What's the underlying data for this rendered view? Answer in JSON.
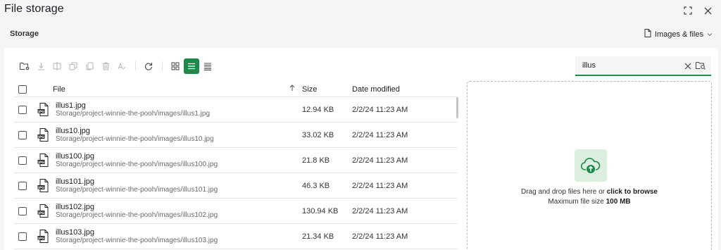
{
  "window": {
    "title": "File storage"
  },
  "breadcrumb": "Storage",
  "scope": {
    "label": "Images & files"
  },
  "search": {
    "value": "illus",
    "placeholder": ""
  },
  "table": {
    "headers": {
      "file": "File",
      "size": "Size",
      "date": "Date modified"
    },
    "rows": [
      {
        "name": "illus1.jpg",
        "path": "Storage/project-winnie-the-pooh/images/illus1.jpg",
        "size": "12.94 KB",
        "date": "2/2/24 11:23 AM"
      },
      {
        "name": "illus10.jpg",
        "path": "Storage/project-winnie-the-pooh/images/illus10.jpg",
        "size": "33.02 KB",
        "date": "2/2/24 11:23 AM"
      },
      {
        "name": "illus100.jpg",
        "path": "Storage/project-winnie-the-pooh/images/illus100.jpg",
        "size": "21.8 KB",
        "date": "2/2/24 11:23 AM"
      },
      {
        "name": "illus101.jpg",
        "path": "Storage/project-winnie-the-pooh/images/illus101.jpg",
        "size": "46.3 KB",
        "date": "2/2/24 11:23 AM"
      },
      {
        "name": "illus102.jpg",
        "path": "Storage/project-winnie-the-pooh/images/illus102.jpg",
        "size": "130.94 KB",
        "date": "2/2/24 11:23 AM"
      },
      {
        "name": "illus103.jpg",
        "path": "Storage/project-winnie-the-pooh/images/illus103.jpg",
        "size": "21.34 KB",
        "date": "2/2/24 11:23 AM"
      }
    ]
  },
  "dropzone": {
    "line1_prefix": "Drag and drop files here or ",
    "line1_link": "click to browse",
    "line2_prefix": "Maximum file size ",
    "line2_value": "100 MB"
  },
  "colors": {
    "accent": "#1b8a4a",
    "upload_bg": "#dcefdf",
    "panel_bg": "#ffffff",
    "page_bg": "#f4f5f6"
  },
  "icons": {
    "toolbar": [
      "new-folder-icon",
      "download-icon",
      "move-icon",
      "copy-icon",
      "duplicate-icon",
      "delete-icon",
      "rename-icon",
      "refresh-icon",
      "grid-view-icon",
      "list-view-icon",
      "details-view-icon"
    ],
    "file": "jpg-file-icon"
  }
}
